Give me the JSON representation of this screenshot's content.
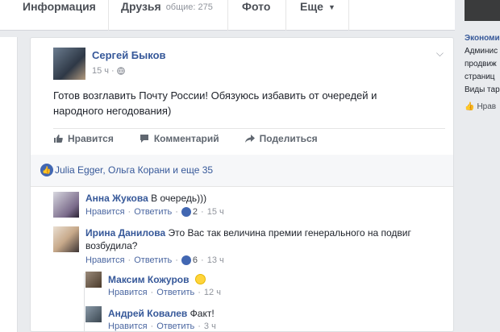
{
  "nav": {
    "tabs": [
      "Информация",
      "Друзья",
      "Фото",
      "Еще"
    ],
    "friends_count": "общие: 275"
  },
  "right": {
    "title": "Экономи",
    "lines": [
      "Админис",
      "продвиж",
      "страниц",
      "Виды тар"
    ],
    "like": "Нрав"
  },
  "post": {
    "author": "Сергей Быков",
    "time": "15 ч",
    "text": "Готов возглавить Почту России! Обязуюсь избавить от очередей и народного негодования)",
    "actions": {
      "like": "Нравится",
      "comment": "Комментарий",
      "share": "Поделиться"
    },
    "reactions": "Julia Egger, Ольга Корани и еще 35"
  },
  "comments": [
    {
      "name": "Анна Жукова",
      "text": "В очередь)))",
      "like": "Нравится",
      "reply": "Ответить",
      "likes": "2",
      "time": "15 ч"
    },
    {
      "name": "Ирина Данилова",
      "text": "Это Вас так величина премии генерального на подвиг возбудила?",
      "like": "Нравится",
      "reply": "Ответить",
      "likes": "6",
      "time": "13 ч"
    },
    {
      "name": "Максим Кожуров",
      "text": "",
      "like": "Нравится",
      "reply": "Ответить",
      "time": "12 ч"
    },
    {
      "name": "Андрей Ковалев",
      "text": "Факт!",
      "like": "Нравится",
      "reply": "Ответить",
      "time": "3 ч"
    }
  ],
  "colors": {
    "link": "#365899",
    "like_blue": "#4267b2",
    "bg": "#e9ebee"
  }
}
